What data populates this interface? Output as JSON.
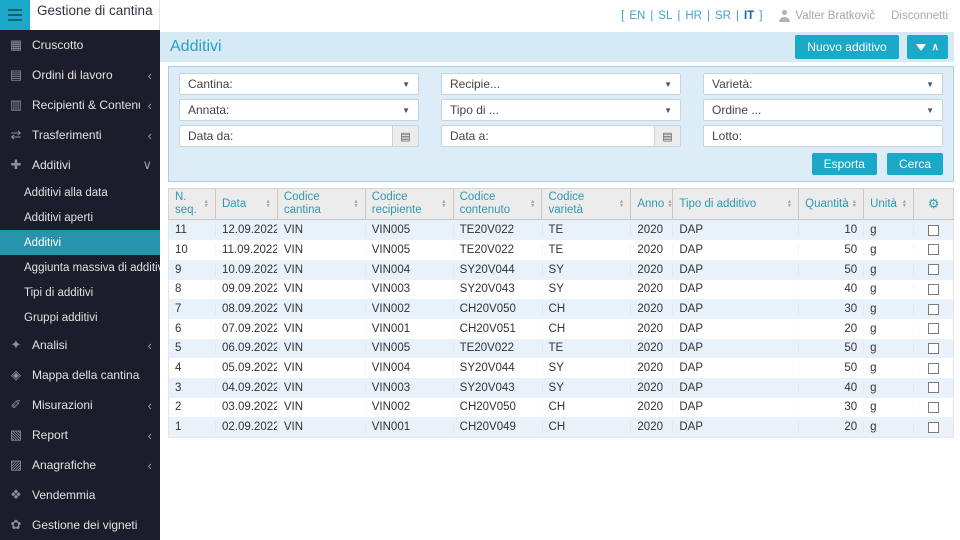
{
  "app": {
    "title": "Gestione di cantina"
  },
  "colors": {
    "accent": "#1ba9c9",
    "sidebar_bg": "#1c1c2b",
    "active_item": "#2794ab",
    "band_bg": "#d5eaf4",
    "stripe": "#e9f2fa",
    "header_text": "#2f99b0"
  },
  "topbar": {
    "bracket_open": "[",
    "bracket_close": "]",
    "separator": "|",
    "languages": [
      "EN",
      "SL",
      "HR",
      "SR",
      "IT"
    ],
    "active_language": "IT",
    "user_name": "Valter Bratkovič",
    "logout_label": "Disconnetti"
  },
  "page": {
    "title": "Additivi",
    "new_button_label": "Nuovo additivo"
  },
  "sidebar": {
    "items": [
      {
        "label": "Cruscotto",
        "icon": "dashboard-icon",
        "glyph": "▦",
        "chevron": ""
      },
      {
        "label": "Ordini di lavoro",
        "icon": "work-orders-icon",
        "glyph": "▤",
        "chevron": "‹"
      },
      {
        "label": "Recipienti & Contenuti",
        "icon": "vessels-icon",
        "glyph": "▥",
        "chevron": "‹"
      },
      {
        "label": "Trasferimenti",
        "icon": "transfers-icon",
        "glyph": "⇄",
        "chevron": "‹"
      },
      {
        "label": "Additivi",
        "icon": "additives-icon",
        "glyph": "✚",
        "chevron": "∨"
      },
      {
        "label": "Analisi",
        "icon": "analysis-icon",
        "glyph": "✦",
        "chevron": "‹"
      },
      {
        "label": "Mappa della cantina",
        "icon": "cellar-map-icon",
        "glyph": "◈",
        "chevron": ""
      },
      {
        "label": "Misurazioni",
        "icon": "measurements-icon",
        "glyph": "✐",
        "chevron": "‹"
      },
      {
        "label": "Report",
        "icon": "report-icon",
        "glyph": "▧",
        "chevron": "‹"
      },
      {
        "label": "Anagrafiche",
        "icon": "registry-icon",
        "glyph": "▨",
        "chevron": "‹"
      },
      {
        "label": "Vendemmia",
        "icon": "harvest-icon",
        "glyph": "❖",
        "chevron": ""
      },
      {
        "label": "Gestione dei vigneti",
        "icon": "vineyards-icon",
        "glyph": "✿",
        "chevron": ""
      }
    ],
    "additivi_submenu": [
      {
        "label": "Additivi alla data",
        "active": false
      },
      {
        "label": "Additivi aperti",
        "active": false
      },
      {
        "label": "Additivi",
        "active": true
      },
      {
        "label": "Aggiunta massiva di additivi",
        "active": false
      },
      {
        "label": "Tipi di additivi",
        "active": false
      },
      {
        "label": "Gruppi additivi",
        "active": false
      }
    ]
  },
  "filters": {
    "cantina_label": "Cantina:",
    "recipiente_label": "Recipie...",
    "varieta_label": "Varietà:",
    "annata_label": "Annata:",
    "tipo_label": "Tipo di ...",
    "ordine_label": "Ordine ...",
    "data_da_label": "Data da:",
    "data_a_label": "Data a:",
    "lotto_label": "Lotto:",
    "export_button": "Esporta",
    "search_button": "Cerca"
  },
  "table": {
    "columns": [
      {
        "label": "N. seq."
      },
      {
        "label": "Data"
      },
      {
        "label": "Codice cantina"
      },
      {
        "label": "Codice recipiente"
      },
      {
        "label": "Codice contenuto"
      },
      {
        "label": "Codice varietà"
      },
      {
        "label": "Anno"
      },
      {
        "label": "Tipo di additivo"
      },
      {
        "label": "Quantità"
      },
      {
        "label": "Unità"
      }
    ],
    "rows": [
      {
        "seq": "11",
        "date": "12.09.2022",
        "cantina": "VIN",
        "recipiente": "VIN005",
        "contenuto": "TE20V022",
        "varieta": "TE",
        "anno": "2020",
        "tipo": "DAP",
        "qty": "10",
        "unit": "g"
      },
      {
        "seq": "10",
        "date": "11.09.2022",
        "cantina": "VIN",
        "recipiente": "VIN005",
        "contenuto": "TE20V022",
        "varieta": "TE",
        "anno": "2020",
        "tipo": "DAP",
        "qty": "50",
        "unit": "g"
      },
      {
        "seq": "9",
        "date": "10.09.2022",
        "cantina": "VIN",
        "recipiente": "VIN004",
        "contenuto": "SY20V044",
        "varieta": "SY",
        "anno": "2020",
        "tipo": "DAP",
        "qty": "50",
        "unit": "g"
      },
      {
        "seq": "8",
        "date": "09.09.2022",
        "cantina": "VIN",
        "recipiente": "VIN003",
        "contenuto": "SY20V043",
        "varieta": "SY",
        "anno": "2020",
        "tipo": "DAP",
        "qty": "40",
        "unit": "g"
      },
      {
        "seq": "7",
        "date": "08.09.2022",
        "cantina": "VIN",
        "recipiente": "VIN002",
        "contenuto": "CH20V050",
        "varieta": "CH",
        "anno": "2020",
        "tipo": "DAP",
        "qty": "30",
        "unit": "g"
      },
      {
        "seq": "6",
        "date": "07.09.2022",
        "cantina": "VIN",
        "recipiente": "VIN001",
        "contenuto": "CH20V051",
        "varieta": "CH",
        "anno": "2020",
        "tipo": "DAP",
        "qty": "20",
        "unit": "g"
      },
      {
        "seq": "5",
        "date": "06.09.2022",
        "cantina": "VIN",
        "recipiente": "VIN005",
        "contenuto": "TE20V022",
        "varieta": "TE",
        "anno": "2020",
        "tipo": "DAP",
        "qty": "50",
        "unit": "g"
      },
      {
        "seq": "4",
        "date": "05.09.2022",
        "cantina": "VIN",
        "recipiente": "VIN004",
        "contenuto": "SY20V044",
        "varieta": "SY",
        "anno": "2020",
        "tipo": "DAP",
        "qty": "50",
        "unit": "g"
      },
      {
        "seq": "3",
        "date": "04.09.2022",
        "cantina": "VIN",
        "recipiente": "VIN003",
        "contenuto": "SY20V043",
        "varieta": "SY",
        "anno": "2020",
        "tipo": "DAP",
        "qty": "40",
        "unit": "g"
      },
      {
        "seq": "2",
        "date": "03.09.2022",
        "cantina": "VIN",
        "recipiente": "VIN002",
        "contenuto": "CH20V050",
        "varieta": "CH",
        "anno": "2020",
        "tipo": "DAP",
        "qty": "30",
        "unit": "g"
      },
      {
        "seq": "1",
        "date": "02.09.2022",
        "cantina": "VIN",
        "recipiente": "VIN001",
        "contenuto": "CH20V049",
        "varieta": "CH",
        "anno": "2020",
        "tipo": "DAP",
        "qty": "20",
        "unit": "g"
      }
    ]
  }
}
